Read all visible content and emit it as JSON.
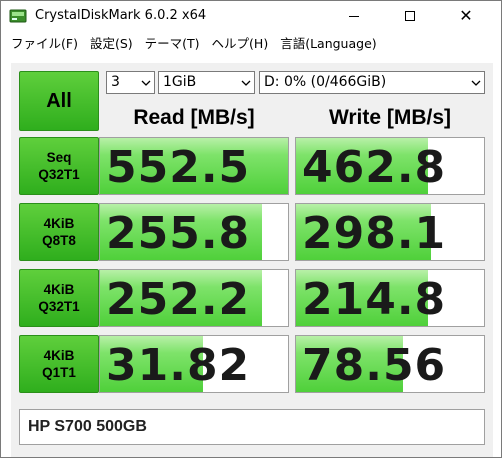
{
  "window": {
    "title": "CrystalDiskMark 6.0.2 x64",
    "close_glyph": "✕"
  },
  "menu": [
    "ファイル(F)",
    "設定(S)",
    "テーマ(T)",
    "ヘルプ(H)",
    "言語(Language)"
  ],
  "controls": {
    "all_label": "All",
    "count_value": "3",
    "size_value": "1GiB",
    "drive_value": "D: 0% (0/466GiB)"
  },
  "headers": {
    "read": "Read [MB/s]",
    "write": "Write [MB/s]"
  },
  "tests": [
    {
      "line1": "Seq",
      "line2": "Q32T1",
      "read": "552.5",
      "write": "462.8",
      "read_fill": 1.0,
      "write_fill": 0.7
    },
    {
      "line1": "4KiB",
      "line2": "Q8T8",
      "read": "255.8",
      "write": "298.1",
      "read_fill": 0.86,
      "write_fill": 0.72
    },
    {
      "line1": "4KiB",
      "line2": "Q32T1",
      "read": "252.2",
      "write": "214.8",
      "read_fill": 0.86,
      "write_fill": 0.7
    },
    {
      "line1": "4KiB",
      "line2": "Q1T1",
      "read": "31.82",
      "write": "78.56",
      "read_fill": 0.55,
      "write_fill": 0.57
    }
  ],
  "comment": "HP S700 500GB",
  "colors": {
    "button_green": "#3cbf26",
    "bar_green": "#4fd03a",
    "panel_bg": "#f0f0f0"
  }
}
